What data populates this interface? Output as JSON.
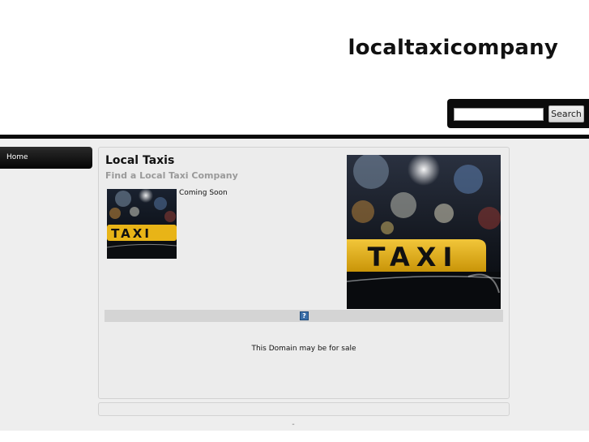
{
  "header": {
    "site_title": "localtaxicompany"
  },
  "search": {
    "placeholder": "",
    "value": "",
    "button_label": "Search"
  },
  "nav": {
    "items": [
      {
        "label": "Home"
      }
    ]
  },
  "post": {
    "title": "Local Taxis",
    "subtitle": "Find a Local Taxi Company",
    "thumb_caption": "Coming Soon",
    "thumb_sign_text": "TAXI",
    "hero_sign_text": "TAXI"
  },
  "ad": {
    "badge": "?"
  },
  "sale_notice": "This Domain may be for sale",
  "footer": {
    "mark": "¨"
  },
  "colors": {
    "taxi_sign": "#e8b417",
    "header_bar": "#0a0a0a",
    "content_bg": "#eeeeee",
    "ad_badge": "#3a6ea8"
  },
  "icons": {
    "ad_badge": "info-badge-icon"
  }
}
